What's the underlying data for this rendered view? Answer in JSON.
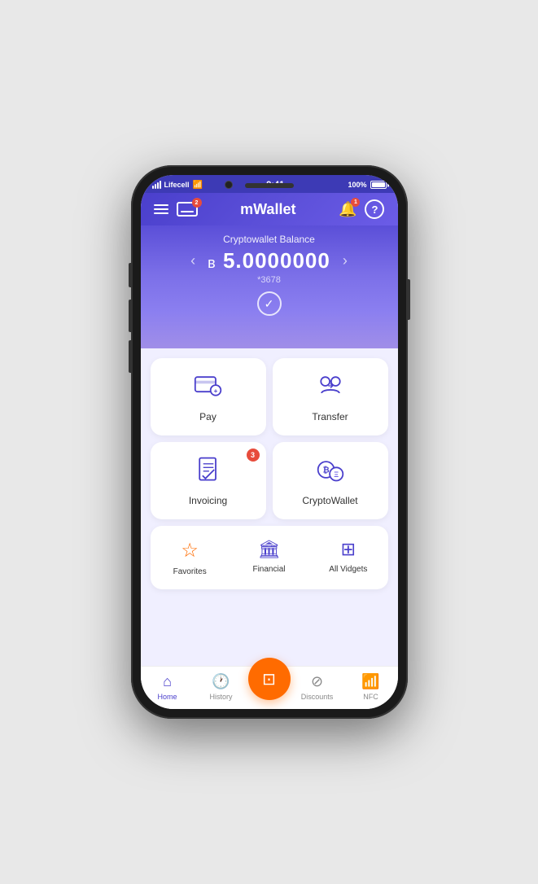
{
  "statusBar": {
    "carrier": "Lifecell",
    "time": "9:41",
    "battery": "100%",
    "signalBars": 4
  },
  "header": {
    "title": "mWallet",
    "cardBadge": "2",
    "bellBadge": "1"
  },
  "balance": {
    "label": "Cryptowallet Balance",
    "currency": "в",
    "amount": "5.0000000",
    "account": "*3678"
  },
  "gridItems": [
    {
      "id": "pay",
      "label": "Pay",
      "badge": null
    },
    {
      "id": "transfer",
      "label": "Transfer",
      "badge": null
    },
    {
      "id": "invoicing",
      "label": "Invoicing",
      "badge": "3"
    },
    {
      "id": "cryptowallet",
      "label": "CryptoWallet",
      "badge": null
    }
  ],
  "widgets": [
    {
      "id": "favorites",
      "label": "Favorites"
    },
    {
      "id": "financial",
      "label": "Financial"
    },
    {
      "id": "allvidgets",
      "label": "All Vidgets"
    }
  ],
  "bottomNav": [
    {
      "id": "home",
      "label": "Home",
      "active": true
    },
    {
      "id": "history",
      "label": "History",
      "active": false
    },
    {
      "id": "scan",
      "label": "",
      "active": false,
      "center": true
    },
    {
      "id": "discounts",
      "label": "Discounts",
      "active": false
    },
    {
      "id": "nfc",
      "label": "NFC",
      "active": false
    }
  ]
}
